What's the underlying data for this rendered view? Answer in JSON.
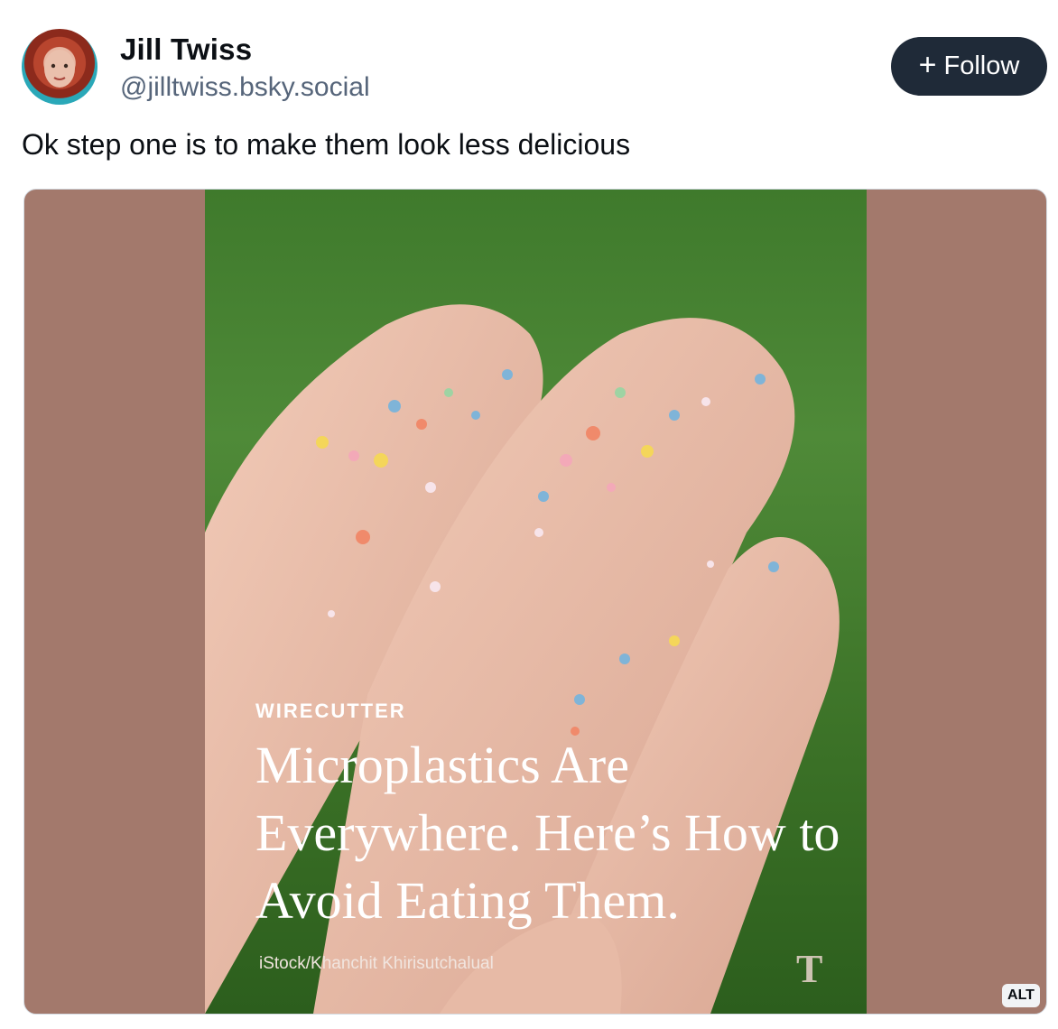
{
  "author": {
    "display_name": "Jill Twiss",
    "handle": "@jilltwiss.bsky.social",
    "avatar_icon": "avatar-photo"
  },
  "follow_button": {
    "icon": "plus-icon",
    "label": "Follow"
  },
  "post": {
    "text": "Ok step one is to make them look less delicious"
  },
  "embed": {
    "kicker": "WIRECUTTER",
    "headline": "Microplastics Are Everywhere. Here’s How to Avoid Eating Them.",
    "credit": "iStock/Khanchit Khirisutchalual",
    "logo": "T",
    "alt_badge": "ALT"
  },
  "colors": {
    "follow_bg": "#1f2a38",
    "embed_bg": "#a3796c",
    "handle": "#56657a"
  }
}
